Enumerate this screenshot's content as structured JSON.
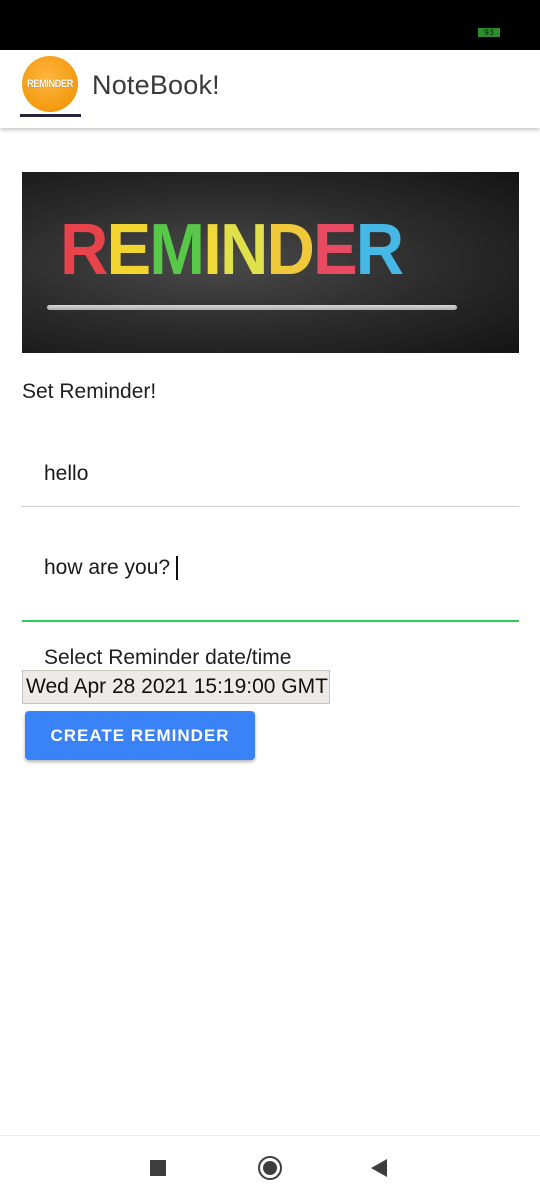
{
  "status_bar": {
    "battery": "93"
  },
  "app_bar": {
    "logo_text": "REMINDER",
    "title": "NoteBook!"
  },
  "banner": {
    "letters": [
      {
        "char": "R",
        "color": "#e8424b"
      },
      {
        "char": "E",
        "color": "#f2d531"
      },
      {
        "char": "M",
        "color": "#58c848"
      },
      {
        "char": "I",
        "color": "#f0d93a"
      },
      {
        "char": "N",
        "color": "#e0e04a"
      },
      {
        "char": "D",
        "color": "#f0c93a"
      },
      {
        "char": "E",
        "color": "#e84a62"
      },
      {
        "char": "R",
        "color": "#45b8e6"
      }
    ]
  },
  "form": {
    "section_label": "Set Reminder!",
    "title_value": "hello",
    "description_value": "how are you?",
    "datetime_label": "Select Reminder date/time",
    "datetime_value": "Wed Apr 28 2021 15:19:00 GMT",
    "create_button": "CREATE REMINDER"
  },
  "colors": {
    "accent_button": "#3a82f7",
    "focused_underline": "#2ecc5b",
    "logo_orange": "#f39a10"
  },
  "nav_bar": {
    "icons": [
      "recents-square-icon",
      "home-circle-icon",
      "back-triangle-icon"
    ]
  }
}
